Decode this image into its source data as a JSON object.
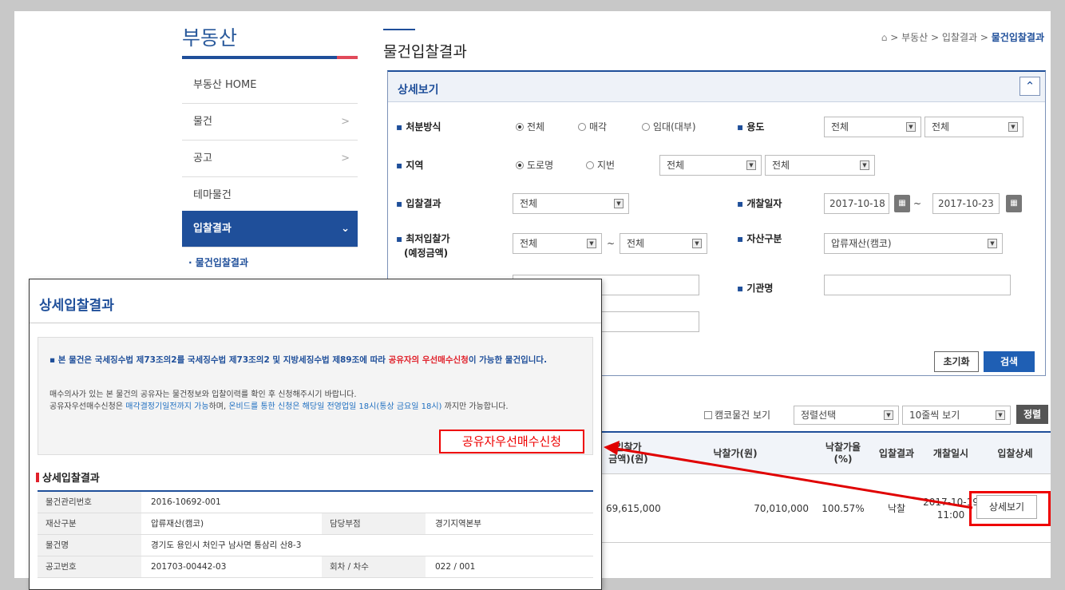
{
  "sidebar": {
    "title": "부동산",
    "items": [
      {
        "label": "부동산 HOME",
        "chevron": ""
      },
      {
        "label": "물건",
        "chevron": ">"
      },
      {
        "label": "공고",
        "chevron": ">"
      },
      {
        "label": "테마물건",
        "chevron": ""
      },
      {
        "label": "입찰결과",
        "chevron": "⌄"
      }
    ],
    "sub_item": "물건입찰결과"
  },
  "header": {
    "title": "물건입찰결과",
    "breadcrumb": {
      "home_icon": "home-icon",
      "path": "> 부동산 > 입찰결과 >",
      "current": "물건입찰결과"
    }
  },
  "search": {
    "panel_title": "상세보기",
    "collapse_icon": "chevron-up-icon",
    "disposal": {
      "label": "처분방식",
      "options": [
        "전체",
        "매각",
        "임대(대부)"
      ],
      "selected": "전체"
    },
    "usage": {
      "label": "용도",
      "select1": "전체",
      "select2": "전체"
    },
    "region": {
      "label": "지역",
      "options": [
        "도로명",
        "지번"
      ],
      "selected": "도로명",
      "select1": "전체",
      "select2": "전체"
    },
    "bid_result": {
      "label": "입찰결과",
      "value": "전체"
    },
    "open_date": {
      "label": "개찰일자",
      "from": "2017-10-18",
      "to": "2017-10-23",
      "calendar_icon": "calendar-icon"
    },
    "min_price": {
      "label_line1": "최저입찰가",
      "label_line2": "(예정금액)",
      "from": "전체",
      "to": "전체"
    },
    "asset_type": {
      "label": "자산구분",
      "value": "압류재산(캠코)"
    },
    "agency": {
      "label": "기관명",
      "value": ""
    },
    "tilde": "~",
    "reset_label": "초기화",
    "search_label": "검색"
  },
  "list_toolbar": {
    "kamco_checkbox": "캠코물건 보기",
    "sort_select": "정렬선택",
    "page_size_select": "10줄씩 보기",
    "sort_button": "정렬"
  },
  "results": {
    "columns": [
      "입찰가\n금액)(원)",
      "낙찰가(원)",
      "낙찰가율\n(%)",
      "입찰결과",
      "개찰일시",
      "입찰상세"
    ],
    "rows": [
      {
        "bid_price": "69,615,000",
        "winning_price": "70,010,000",
        "rate": "100.57%",
        "result": "낙찰",
        "open_date": "2017-10-19",
        "open_time": "11:00",
        "detail_button": "상세보기"
      }
    ]
  },
  "popup": {
    "title": "상세입찰결과",
    "notice_bold_1": "본 물건은 국세징수법 제73조의2를 국세징수법 제73조의2 및 지방세징수법 제89조에 따라 ",
    "notice_red": "공유자의 우선매수신청",
    "notice_bold_2": "이 가능한 물건입니다.",
    "notice_line_1": "매수의사가 있는 본 물건의 공유자는 물건정보와 입찰이력를 확인 후 신청해주시기 바랍니다.",
    "notice_line_2a": "공유자우선매수신청은 ",
    "notice_blue_1": "매각결정기일전까지 가능",
    "notice_line_2b": "하며, ",
    "notice_blue_2": "온비드를 통한 신청은 해당일 전영업일 18시(통상 금요일 18시)",
    "notice_line_2c": " 까지만 가능합니다.",
    "priority_button": "공유자우선매수신청",
    "section_title": "상세입찰결과",
    "rows": [
      {
        "k1": "물건관리번호",
        "v1": "2016-10692-001",
        "k2": "",
        "v2": ""
      },
      {
        "k1": "재산구분",
        "v1": "압류재산(캠코)",
        "k2": "담당부점",
        "v2": "경기지역본부"
      },
      {
        "k1": "물건명",
        "v1": "경기도 용인시 처인구 남사면 통삼리 산8-3",
        "k2": "",
        "v2": ""
      },
      {
        "k1": "공고번호",
        "v1": "201703-00442-03",
        "k2": "회차 / 차수",
        "v2": "022 / 001"
      }
    ]
  },
  "annotation_color": "#e00000"
}
